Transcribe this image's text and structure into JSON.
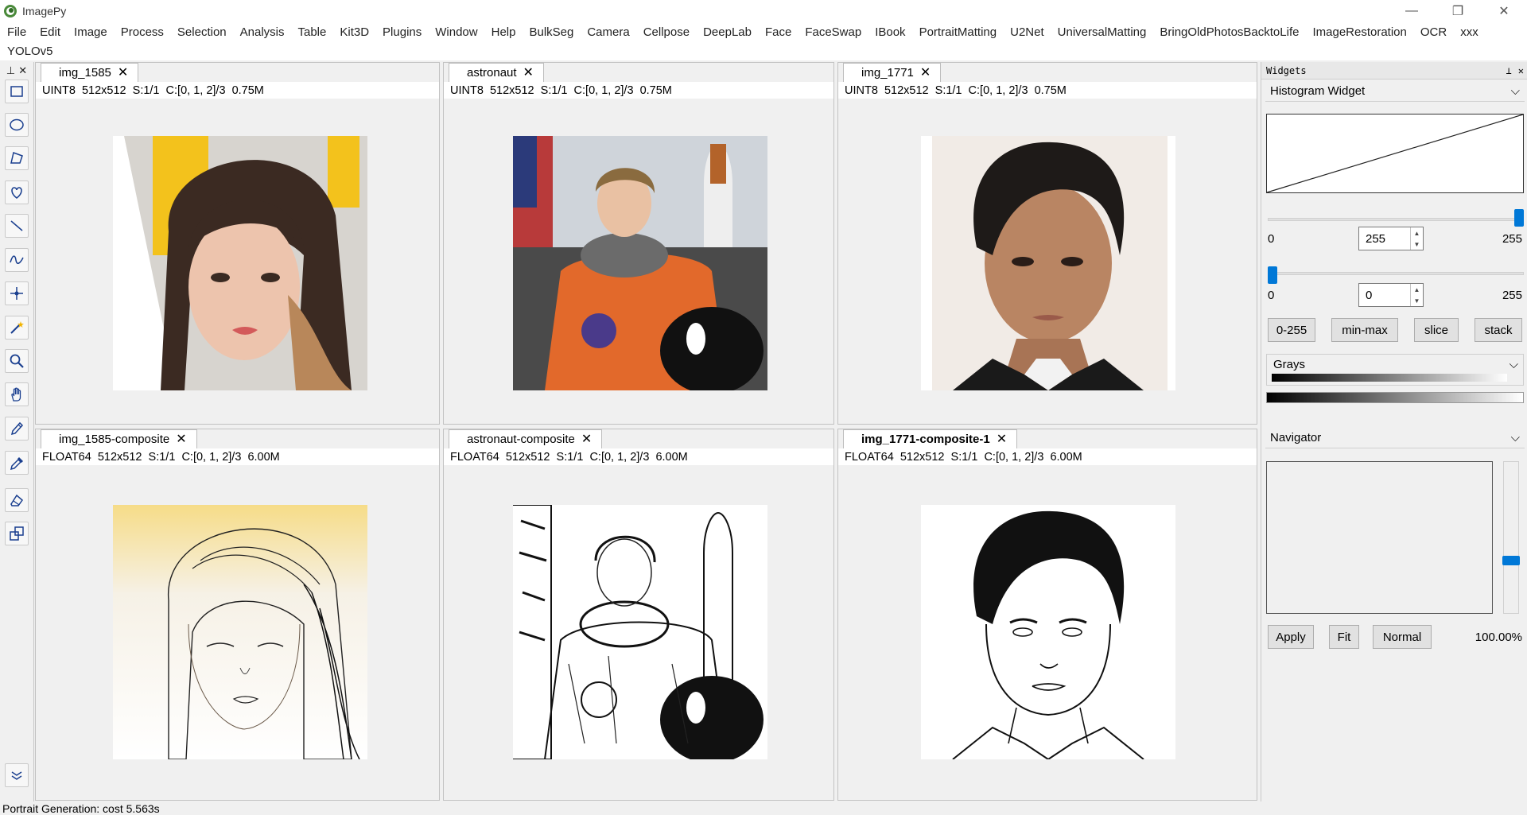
{
  "app": {
    "title": "ImagePy"
  },
  "window": {
    "minimize": "—",
    "restore": "❐",
    "close": "✕"
  },
  "menu": {
    "row1": [
      "File",
      "Edit",
      "Image",
      "Process",
      "Selection",
      "Analysis",
      "Table",
      "Kit3D",
      "Plugins",
      "Window",
      "Help",
      "BulkSeg",
      "Camera",
      "Cellpose",
      "DeepLab",
      "Face",
      "FaceSwap",
      "IBook",
      "PortraitMatting",
      "U2Net",
      "UniversalMatting",
      "BringOldPhotosBacktoLife",
      "ImageRestoration",
      "OCR",
      "xxx"
    ],
    "row2": [
      "YOLOv5"
    ]
  },
  "toolbar": {
    "pin": "⊥",
    "close": "✕",
    "tools": [
      "rectangle-select-icon",
      "ellipse-select-icon",
      "polygon-select-icon",
      "freehand-select-icon",
      "line-icon",
      "polyline-icon",
      "point-icon",
      "magic-wand-icon",
      "zoom-icon",
      "hand-icon",
      "pencil-icon",
      "color-picker-icon",
      "eraser-icon",
      "transform-icon"
    ],
    "more": "more-tools-icon"
  },
  "panels": [
    {
      "tab": "img_1585",
      "info": "UINT8  512x512  S:1/1  C:[0, 1, 2]/3  0.75M"
    },
    {
      "tab": "astronaut",
      "info": "UINT8  512x512  S:1/1  C:[0, 1, 2]/3  0.75M"
    },
    {
      "tab": "img_1771",
      "info": "UINT8  512x512  S:1/1  C:[0, 1, 2]/3  0.75M"
    },
    {
      "tab": "img_1585-composite",
      "info": "FLOAT64  512x512  S:1/1  C:[0, 1, 2]/3  6.00M"
    },
    {
      "tab": "astronaut-composite",
      "info": "FLOAT64  512x512  S:1/1  C:[0, 1, 2]/3  6.00M"
    },
    {
      "tab": "img_1771-composite-1",
      "info": "FLOAT64  512x512  S:1/1  C:[0, 1, 2]/3  6.00M"
    }
  ],
  "widgets": {
    "header": "Widgets",
    "pin": "⊥",
    "close": "✕",
    "histogram": {
      "title": "Histogram Widget",
      "slider_high": {
        "min": "0",
        "value": "255",
        "max": "255",
        "level": 1.0
      },
      "slider_low": {
        "min": "0",
        "value": "0",
        "max": "255",
        "level": 0.0
      },
      "buttons": [
        "0-255",
        "min-max",
        "slice",
        "stack"
      ],
      "colormap": "Grays"
    },
    "navigator": {
      "title": "Navigator",
      "buttons": [
        "Apply",
        "Fit",
        "Normal"
      ],
      "zoom": "100.00%"
    }
  },
  "status": {
    "text": "Portrait Generation: cost 5.563s"
  },
  "colors": {
    "accent": "#0078d7",
    "panel_bg": "#f0f0f0"
  }
}
